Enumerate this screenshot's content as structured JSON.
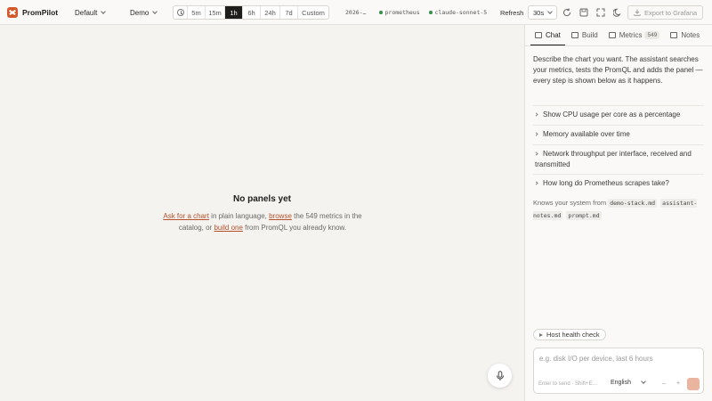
{
  "app": {
    "name": "PromPilot"
  },
  "header": {
    "workspace": "Default",
    "dashboard": "Demo",
    "time_ranges": [
      "5m",
      "15m",
      "1h",
      "6h",
      "24h",
      "7d",
      "Custom"
    ],
    "active_range": "1h",
    "date_label": "2026-…",
    "datasource": "prometheus",
    "model": "claude-sonnet-5",
    "refresh_label": "Refresh",
    "refresh_value": "30s",
    "export_label": "Export to Grafana"
  },
  "main": {
    "empty_title": "No panels yet",
    "desc_link1": "Ask for a chart",
    "desc_text1": " in plain language, ",
    "desc_link2": "browse",
    "desc_text2": " the 549 metrics in the catalog, or ",
    "desc_link3": "build one",
    "desc_text3": " from PromQL you already know."
  },
  "panel": {
    "tabs": [
      {
        "label": "Chat"
      },
      {
        "label": "Build"
      },
      {
        "label": "Metrics",
        "badge": "549"
      },
      {
        "label": "Notes"
      }
    ],
    "intro": "Describe the chart you want. The assistant searches your metrics, tests the PromQL and adds the panel — every step is shown below as it happens.",
    "suggestions": [
      "Show CPU usage per core as a percentage",
      "Memory available over time",
      "Network throughput per interface, received and transmitted",
      "How long do Prometheus scrapes take?"
    ],
    "knows_label": "Knows your system from",
    "knows_files": [
      "demo-stack.md",
      "assistant-notes.md",
      "prompt.md"
    ],
    "chip": "Host health check",
    "placeholder": "e.g. disk I/O per device, last 6 hours",
    "hint": "Enter to send · Shift+E…",
    "language": "English",
    "minus": "–",
    "plus": "+"
  }
}
